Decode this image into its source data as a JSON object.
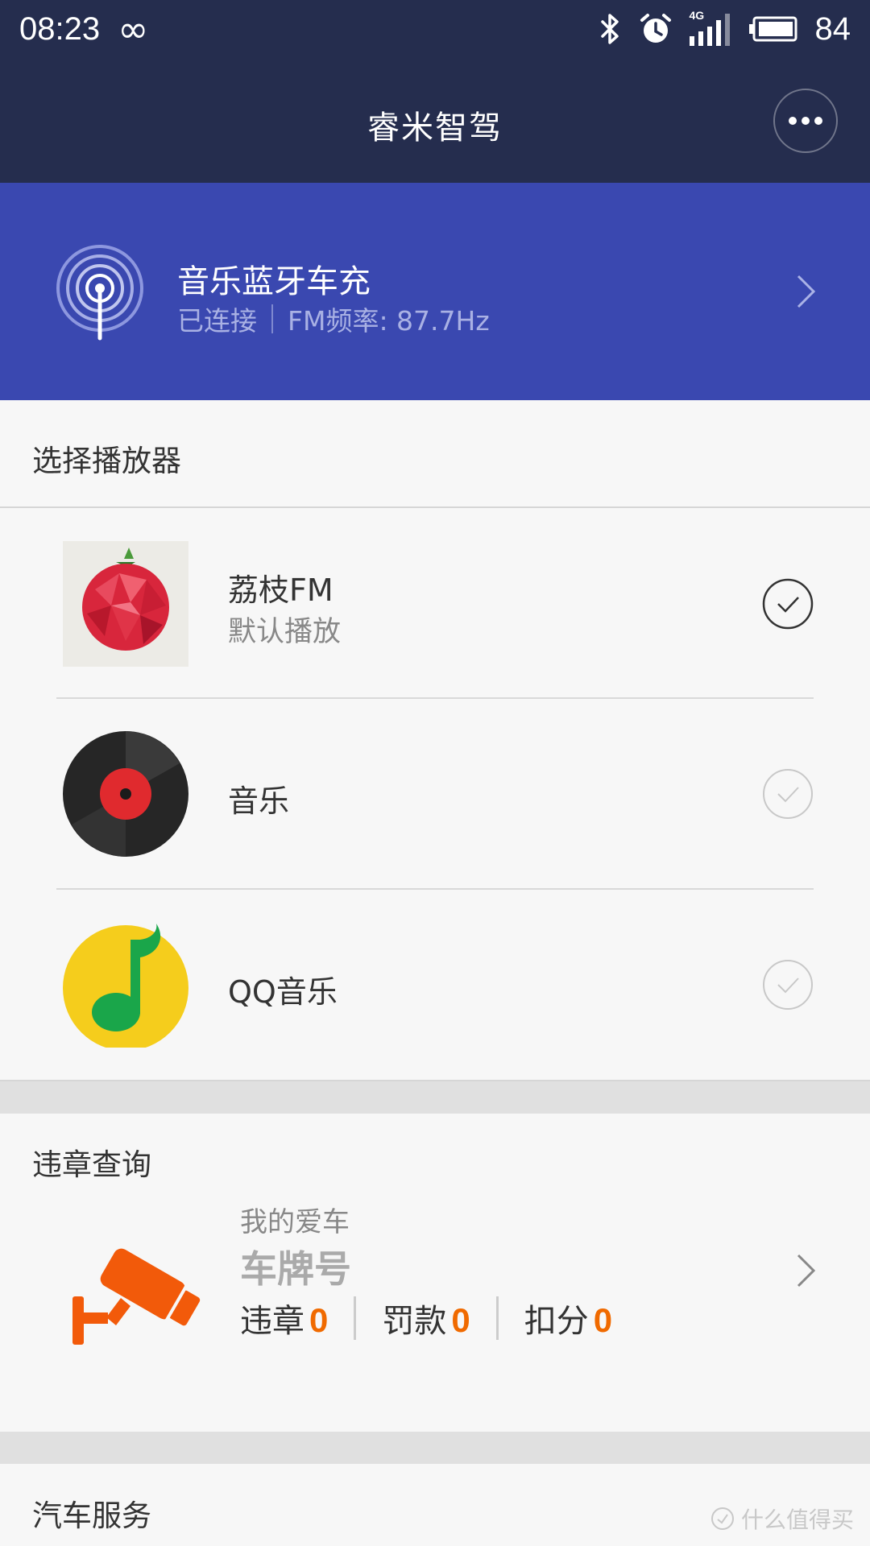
{
  "status_bar": {
    "time": "08:23",
    "network": "4G",
    "battery": "84"
  },
  "header": {
    "title": "睿米智驾"
  },
  "device": {
    "name": "音乐蓝牙车充",
    "status": "已连接",
    "fm": "FM频率: 87.7Hz"
  },
  "player_section": {
    "title": "选择播放器",
    "players": [
      {
        "name": "荔枝FM",
        "subtitle": "默认播放",
        "selected": true,
        "icon": "lychee-icon"
      },
      {
        "name": "音乐",
        "subtitle": "",
        "selected": false,
        "icon": "vinyl-record-icon"
      },
      {
        "name": "QQ音乐",
        "subtitle": "",
        "selected": false,
        "icon": "music-note-icon"
      }
    ]
  },
  "violation_section": {
    "title": "违章查询",
    "caption": "我的爱车",
    "plate": "车牌号",
    "stats": [
      {
        "label": "违章",
        "value": "0"
      },
      {
        "label": "罚款",
        "value": "0"
      },
      {
        "label": "扣分",
        "value": "0"
      }
    ]
  },
  "service_section": {
    "title": "汽车服务"
  },
  "watermark": "什么值得买",
  "colors": {
    "header_bg": "#252d4e",
    "device_bg": "#3a48b0",
    "accent_orange": "#f06a00"
  }
}
